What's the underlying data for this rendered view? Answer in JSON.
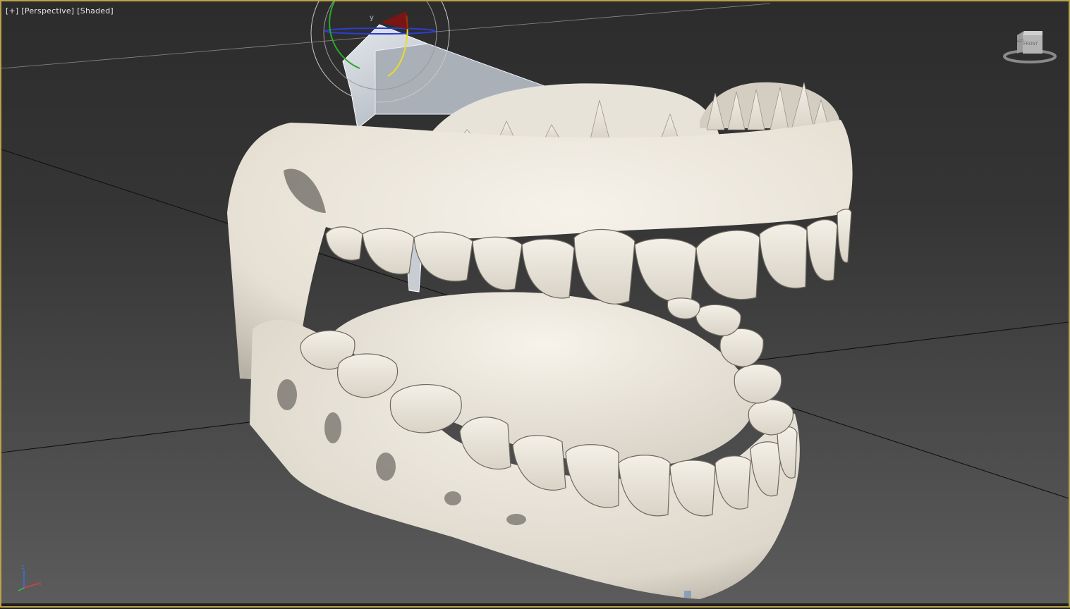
{
  "viewport": {
    "label_plus": "[+]",
    "label_view": "[Perspective]",
    "label_shading": "[Shaded]"
  },
  "gizmo": {
    "axis_y": "y"
  },
  "viewcube": {
    "face_front": "FRONT",
    "face_left": "LEFT"
  },
  "axis_tripod": {
    "z": "z",
    "x": "x"
  },
  "colors": {
    "border": "#bba24a",
    "model": "#ece7dd",
    "gizmo_bone": "#c6ccd3"
  }
}
